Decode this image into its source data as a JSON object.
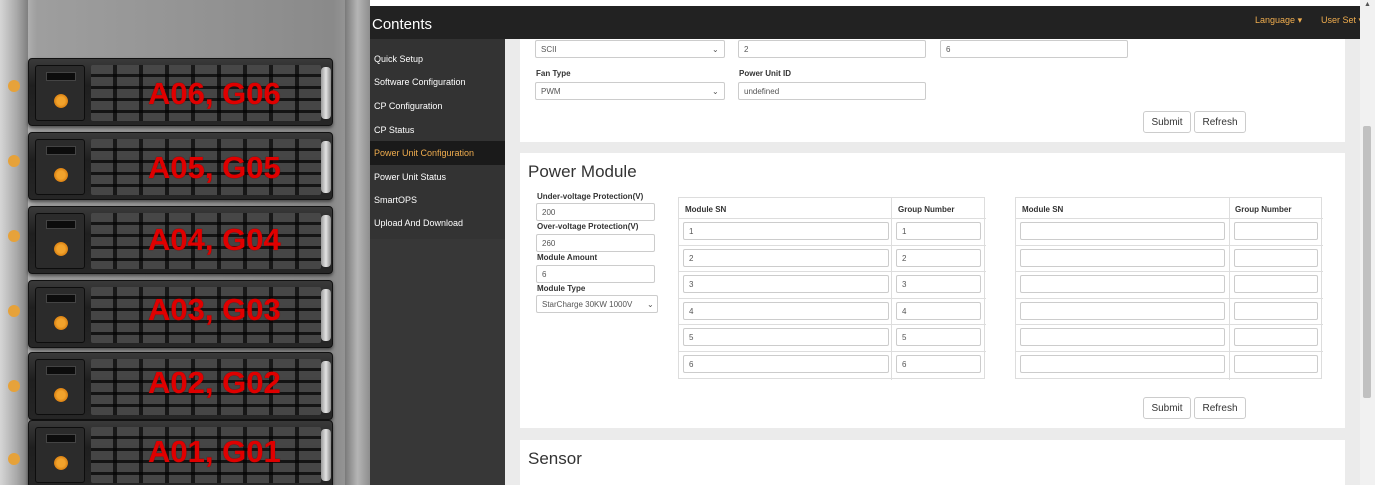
{
  "photo": {
    "rack_labels": [
      "A06, G06",
      "A05, G05",
      "A04, G04",
      "A03, G03",
      "A02, G02",
      "A01, G01"
    ]
  },
  "navbar": {
    "title": "Contents",
    "language_label": "Language",
    "user_label": "User Set"
  },
  "sidebar": {
    "items": [
      {
        "label": "Quick Setup"
      },
      {
        "label": "Software Configuration"
      },
      {
        "label": "CP Configuration"
      },
      {
        "label": "CP Status"
      },
      {
        "label": "Power Unit Configuration"
      },
      {
        "label": "Power Unit Status"
      },
      {
        "label": "SmartOPS"
      },
      {
        "label": "Upload And Download"
      }
    ],
    "active_index": 4
  },
  "power_unit_panel": {
    "row1": {
      "select_value": "SCII",
      "field2_value": "2",
      "field3_value": "6"
    },
    "fan_type": {
      "label": "Fan Type",
      "value": "PWM"
    },
    "power_unit_id": {
      "label": "Power Unit ID",
      "value": "undefined"
    },
    "submit_label": "Submit",
    "refresh_label": "Refresh"
  },
  "power_module": {
    "title": "Power Module",
    "under_voltage": {
      "label": "Under-voltage Protection(V)",
      "value": "200"
    },
    "over_voltage": {
      "label": "Over-voltage Protection(V)",
      "value": "260"
    },
    "module_amount": {
      "label": "Module Amount",
      "value": "6"
    },
    "module_type": {
      "label": "Module Type",
      "value": "StarCharge 30KW 1000V"
    },
    "table_left": {
      "col_sn": "Module SN",
      "col_group": "Group Number",
      "rows": [
        {
          "sn": "1",
          "group": "1"
        },
        {
          "sn": "2",
          "group": "2"
        },
        {
          "sn": "3",
          "group": "3"
        },
        {
          "sn": "4",
          "group": "4"
        },
        {
          "sn": "5",
          "group": "5"
        },
        {
          "sn": "6",
          "group": "6"
        }
      ]
    },
    "table_right": {
      "col_sn": "Module SN",
      "col_group": "Group Number",
      "rows": [
        {
          "sn": "",
          "group": ""
        },
        {
          "sn": "",
          "group": ""
        },
        {
          "sn": "",
          "group": ""
        },
        {
          "sn": "",
          "group": ""
        },
        {
          "sn": "",
          "group": ""
        },
        {
          "sn": "",
          "group": ""
        }
      ]
    },
    "submit_label": "Submit",
    "refresh_label": "Refresh"
  },
  "sensor": {
    "title": "Sensor"
  },
  "colors": {
    "navbar_bg": "#222222",
    "sidebar_bg": "#333333",
    "accent": "#f0ad4e",
    "content_bg": "#ebebeb",
    "label_red": "#e00000"
  }
}
